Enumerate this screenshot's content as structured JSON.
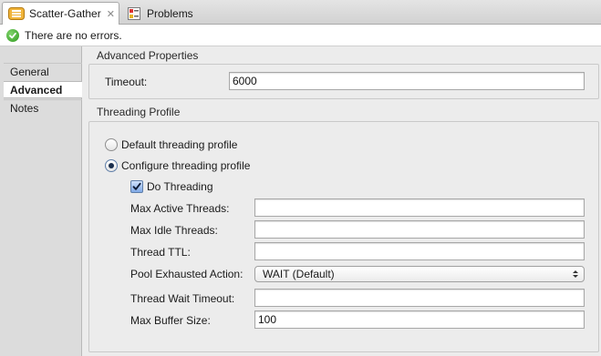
{
  "tabs": [
    {
      "label": "Scatter-Gather",
      "icon": "scatter-gather-icon",
      "active": true,
      "close": "✕"
    },
    {
      "label": "Problems",
      "icon": "problems-icon",
      "active": false
    }
  ],
  "status": {
    "message": "There are no errors."
  },
  "nav": {
    "items": [
      {
        "label": "General",
        "selected": false
      },
      {
        "label": "Advanced",
        "selected": true
      },
      {
        "label": "Notes",
        "selected": false
      }
    ]
  },
  "advanced": {
    "title": "Advanced Properties",
    "timeout_label": "Timeout:",
    "timeout_value": "6000"
  },
  "threading": {
    "title": "Threading Profile",
    "default_label": "Default threading profile",
    "configure_label": "Configure threading profile",
    "selected": "configure",
    "do_threading_label": "Do Threading",
    "do_threading_checked": true,
    "max_active_label": "Max Active Threads:",
    "max_active_value": "",
    "max_idle_label": "Max Idle Threads:",
    "max_idle_value": "",
    "ttl_label": "Thread TTL:",
    "ttl_value": "",
    "pool_label": "Pool Exhausted Action:",
    "pool_value": "WAIT (Default)",
    "wait_timeout_label": "Thread Wait Timeout:",
    "wait_timeout_value": "",
    "buffer_label": "Max Buffer Size:",
    "buffer_value": "100"
  },
  "colors": {
    "accent": "#5f7ea8",
    "ok": "#2f9a1f"
  }
}
